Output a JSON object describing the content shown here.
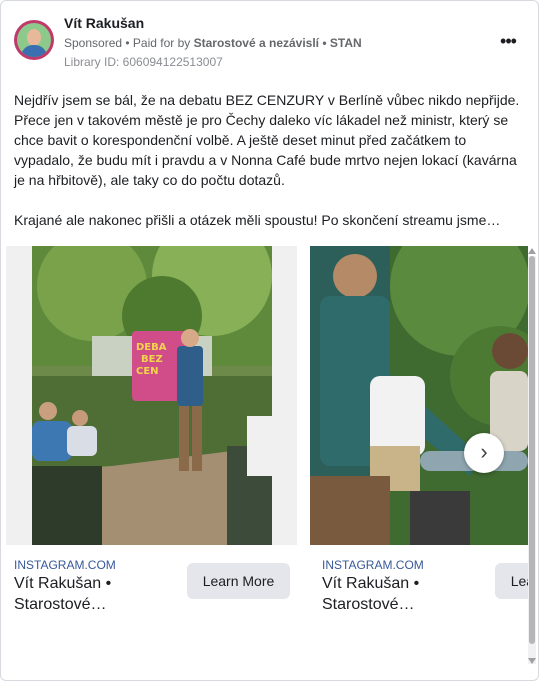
{
  "advertiser": {
    "name": "Vít Rakušan",
    "sponsored": "Sponsored",
    "paid_for_prefix": " • Paid for by ",
    "paid_for_name": "Starostové a nezávislí • STAN",
    "library_id": "Library ID: 606094122513007",
    "more_icon": "more-horizontal-icon"
  },
  "post": {
    "paragraph1": "Nejdřív jsem se bál, že na debatu BEZ CENZURY v Berlíně vůbec nikdo nepřijde. Přece jen v takovém městě je pro Čechy daleko víc lákadel než ministr, který se chce bavit o korespondenční volbě. A ještě deset minut před začátkem to vypadalo, že budu mít i pravdu a v Nonna Café bude mrtvo nejen lokací (kavárna je na hřbitově), ale taky co do počtu dotazů.",
    "paragraph2": "Krajané ale nakonec přišli a otázek měli spoustu! Po skončení streamu jsme…"
  },
  "carousel": {
    "slides": [
      {
        "source": "INSTAGRAM.COM",
        "title": "Vít Rakušan • Starostové…",
        "button": "Learn More",
        "sign_text": "DEBA BEZ CEN"
      },
      {
        "source": "INSTAGRAM.COM",
        "title": "Vít Rakušan • Starostové…",
        "button": "Learn More"
      }
    ],
    "next_icon": "chevron-right-icon"
  },
  "colors": {
    "link": "#385898",
    "button_bg": "#e4e6eb",
    "avatar_ring": "#c0396b"
  }
}
